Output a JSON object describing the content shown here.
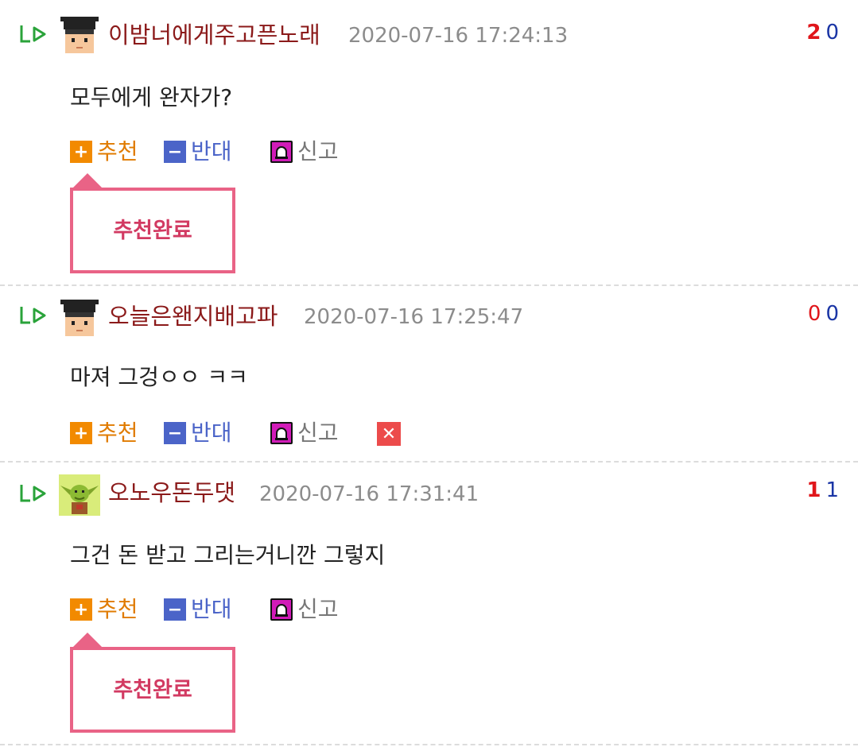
{
  "comments": [
    {
      "nickname": "이밤너에게주고픈노래",
      "date": "2020-07-16 17:24:13",
      "upvotes": "2",
      "downvotes": "0",
      "text": "모두에게 완자가?",
      "avatar_icon": "graduate-avatar-icon",
      "recommend_label": "추천",
      "oppose_label": "반대",
      "report_label": "신고",
      "popup_text": "추천완료"
    },
    {
      "nickname": "오늘은왠지배고파",
      "date": "2020-07-16 17:25:47",
      "upvotes": "0",
      "downvotes": "0",
      "text": "마져 그겅ㅇㅇ ㅋㅋ",
      "avatar_icon": "graduate-avatar-icon",
      "recommend_label": "추천",
      "oppose_label": "반대",
      "report_label": "신고",
      "delete_symbol": "✕"
    },
    {
      "nickname": "오노우돈두댓",
      "date": "2020-07-16 17:31:41",
      "upvotes": "1",
      "downvotes": "1",
      "text": "그건 돈 받고 그리는거니깐 그렇지",
      "avatar_icon": "goblin-avatar-icon",
      "recommend_label": "추천",
      "oppose_label": "반대",
      "report_label": "신고",
      "popup_text": "추천완료"
    }
  ],
  "colors": {
    "nickname": "#8b1a1a",
    "upvote": "#e0161b",
    "downvote": "#1a35a5",
    "recommend": "#f28a00",
    "oppose": "#4b64c8",
    "report": "#d11bb8",
    "popup_border": "#e96386",
    "delete": "#ec4b4b"
  }
}
